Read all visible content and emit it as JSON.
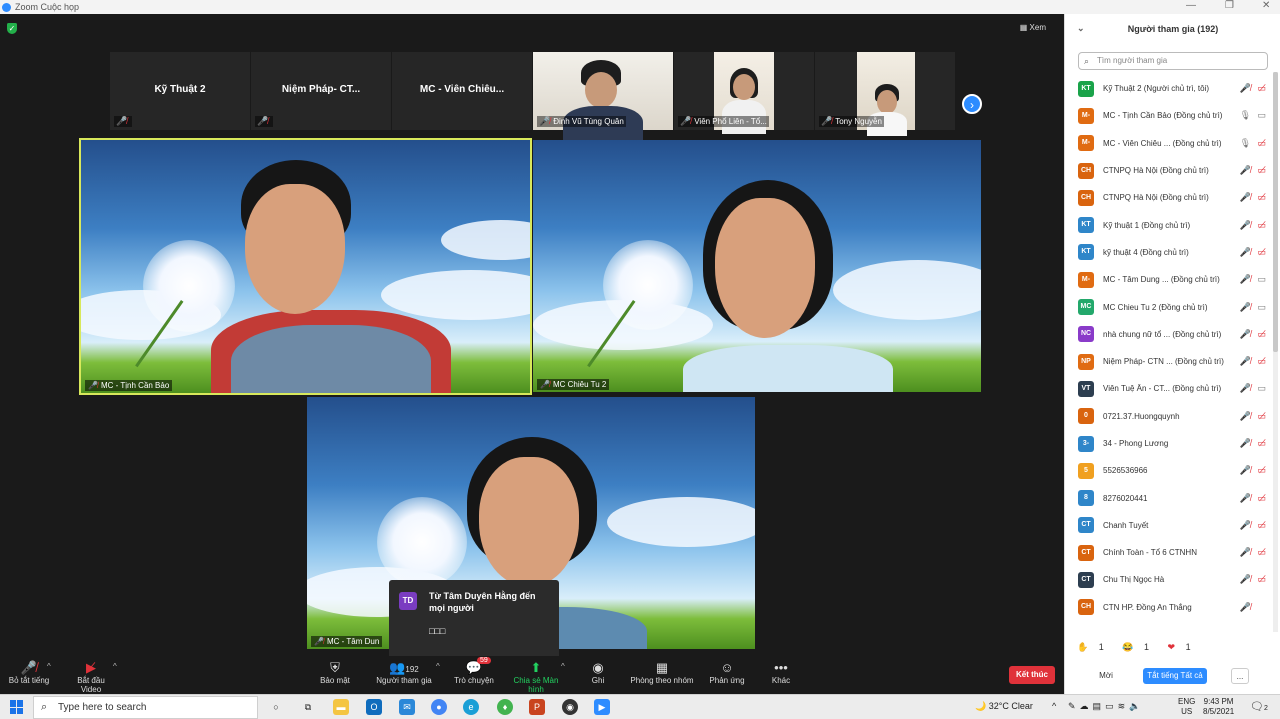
{
  "window": {
    "title": "Zoom Cuộc họp",
    "view_label": "Xem"
  },
  "thumbnails": [
    {
      "name": "Kỹ Thuật 2",
      "video": false
    },
    {
      "name": "Niệm Pháp- CT...",
      "video": false
    },
    {
      "name": "MC - Viên Chiêu...",
      "video": false
    },
    {
      "label": "Đinh Vũ Tùng Quân",
      "video": true
    },
    {
      "label": "Viên Phổ Liên - Tổ...",
      "video": true
    },
    {
      "label": "Tony Nguyễn",
      "video": true
    }
  ],
  "videos": [
    {
      "label": "MC - Tịnh Cần Bảo",
      "active": true
    },
    {
      "label": "MC Chiêu Tu 2",
      "active": false
    },
    {
      "label": "MC - Tâm Dun",
      "active": false
    }
  ],
  "chat_popup": {
    "avatar": "TD",
    "message": "Từ Tâm Duyên Hằng đến mọi người",
    "text": "□□□"
  },
  "toolbar": {
    "mute_all": "Bỏ tắt tiếng",
    "start_video": "Bắt đầu Video",
    "security": "Bảo mật",
    "participants": "Người tham gia",
    "participants_count": "192",
    "chat": "Trò chuyện",
    "chat_badge": "59",
    "share": "Chia sẻ Màn hình",
    "record": "Ghi",
    "breakout": "Phòng theo nhóm",
    "reactions": "Phản ứng",
    "more": "Khác",
    "end": "Kết thúc"
  },
  "panel": {
    "title": "Người tham gia (192)",
    "search_placeholder": "Tìm người tham gia",
    "participants": [
      {
        "initials": "KT",
        "color": "#1aa34a",
        "name": "Kỹ Thuật 2 (Người chủ trì, tôi)",
        "mic": "muted",
        "cam": "off"
      },
      {
        "initials": "M-",
        "color": "#e06b12",
        "name": "MC - Tịnh Cần Bảo (Đồng chủ trì)",
        "mic": "on",
        "cam": "on"
      },
      {
        "initials": "M-",
        "color": "#e06b12",
        "name": "MC - Viên Chiêu ... (Đồng chủ trì)",
        "mic": "on",
        "cam": "off"
      },
      {
        "initials": "CH",
        "color": "#d9640f",
        "name": "CTNPQ Hà Nội (Đồng chủ trì)",
        "mic": "muted",
        "cam": "off"
      },
      {
        "initials": "CH",
        "color": "#d9640f",
        "name": "CTNPQ Hà Nội (Đồng chủ trì)",
        "mic": "muted",
        "cam": "off"
      },
      {
        "initials": "KT",
        "color": "#2f86c9",
        "name": "Kỹ thuật 1 (Đồng chủ trì)",
        "mic": "muted",
        "cam": "off"
      },
      {
        "initials": "KT",
        "color": "#2f86c9",
        "name": "kỹ thuật 4 (Đồng chủ trì)",
        "mic": "muted",
        "cam": "off"
      },
      {
        "initials": "M-",
        "color": "#e06b12",
        "name": "MC - Tâm Dung ... (Đồng chủ trì)",
        "mic": "muted",
        "cam": "on"
      },
      {
        "initials": "MC",
        "color": "#23a86b",
        "name": "MC Chieu Tu 2 (Đồng chủ trì)",
        "mic": "muted",
        "cam": "on"
      },
      {
        "initials": "NC",
        "color": "#8a3bc9",
        "name": "nhà chung nữ tổ ... (Đồng chủ trì)",
        "mic": "muted",
        "cam": "off"
      },
      {
        "initials": "NP",
        "color": "#e06b12",
        "name": "Niệm Pháp- CTN ... (Đồng chủ trì)",
        "mic": "muted",
        "cam": "off"
      },
      {
        "initials": "VT",
        "color": "#2d3e50",
        "name": "Viên Tuệ Ân - CT... (Đồng chủ trì)",
        "mic": "muted",
        "cam": "on"
      },
      {
        "initials": "0",
        "color": "#d9640f",
        "name": "0721.37.Huongquynh",
        "mic": "muted",
        "cam": "off"
      },
      {
        "initials": "3-",
        "color": "#2f86c9",
        "name": "34 - Phong Lương",
        "mic": "muted",
        "cam": "off"
      },
      {
        "initials": "5",
        "color": "#f0a020",
        "name": "5526536966",
        "mic": "muted",
        "cam": "off"
      },
      {
        "initials": "8",
        "color": "#2f86c9",
        "name": "8276020441",
        "mic": "muted",
        "cam": "off"
      },
      {
        "initials": "CT",
        "color": "#2f86c9",
        "name": "Chanh Tuyết",
        "mic": "muted",
        "cam": "off"
      },
      {
        "initials": "CT",
        "color": "#d9640f",
        "name": "Chính Toàn - Tổ 6 CTNHN",
        "mic": "muted",
        "cam": "off"
      },
      {
        "initials": "CT",
        "color": "#2d3e50",
        "name": "Chu Thị Ngọc Hà",
        "mic": "muted",
        "cam": "off"
      },
      {
        "initials": "CH",
        "color": "#d9640f",
        "name": "CTN HP. Đồng An Thắng",
        "mic": "muted",
        "cam": "none"
      }
    ],
    "reactions": [
      {
        "icon": "✋",
        "count": "1"
      },
      {
        "icon": "😂",
        "count": "1"
      },
      {
        "icon": "❤",
        "count": "1"
      }
    ],
    "mute_button": "Mời",
    "mute_all_button": "Tắt tiếng Tất cả",
    "more_button": "..."
  },
  "taskbar": {
    "search_placeholder": "Type here to search",
    "weather": "32°C",
    "weather_text": "Clear",
    "lang_top": "ENG",
    "lang_bottom": "US",
    "time": "9:43 PM",
    "date": "8/5/2021",
    "notif_count": "2"
  }
}
